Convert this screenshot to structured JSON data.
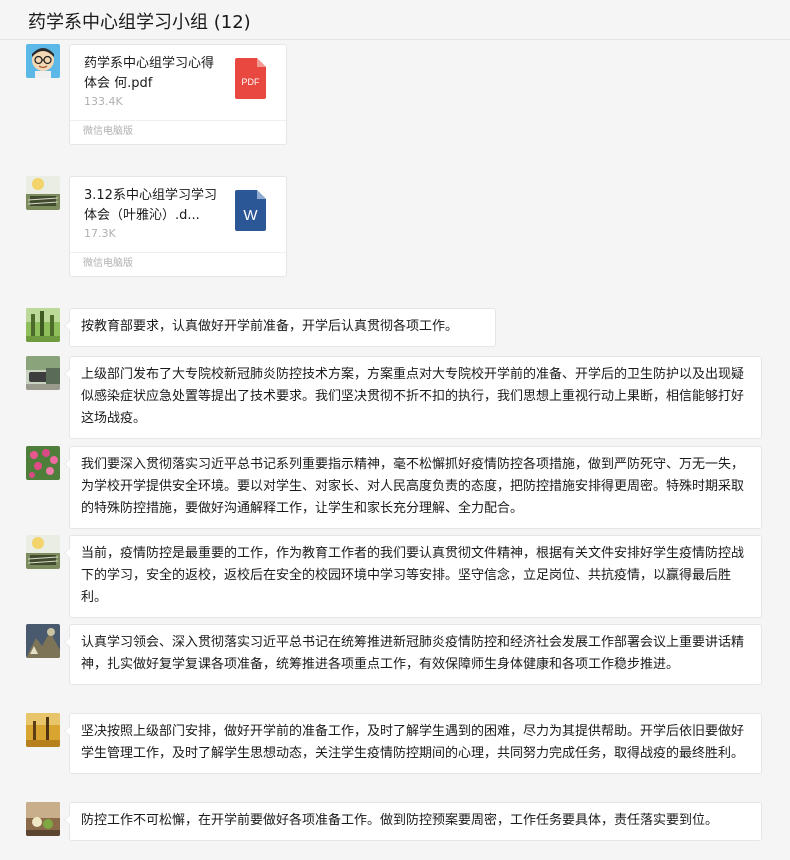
{
  "header": {
    "title": "药学系中心组学习小组 (12)"
  },
  "messages": [
    {
      "type": "file",
      "file_name": "药学系中心组学习心得体会 何.pdf",
      "file_size": "133.4K",
      "file_icon": "pdf-file-icon",
      "icon_label": "PDF",
      "icon_color": "#e8483f",
      "source": "微信电脑版"
    },
    {
      "type": "file",
      "file_name": "3.12系中心组学习学习体会（叶雅沁）.d...",
      "file_size": "17.3K",
      "file_icon": "word-file-icon",
      "icon_label": "W",
      "icon_color": "#2b5797",
      "source": "微信电脑版"
    },
    {
      "type": "text",
      "text": "按教育部要求，认真做好开学前准备，开学后认真贯彻各项工作。"
    },
    {
      "type": "text",
      "text": "上级部门发布了大专院校新冠肺炎防控技术方案，方案重点对大专院校开学前的准备、开学后的卫生防护以及出现疑似感染症状应急处置等提出了技术要求。我们坚决贯彻不折不扣的执行，我们思想上重视行动上果断，相信能够打好这场战疫。"
    },
    {
      "type": "text",
      "text": "我们要深入贯彻落实习近平总书记系列重要指示精神，毫不松懈抓好疫情防控各项措施，做到严防死守、万无一失，为学校开学提供安全环境。要以对学生、对家长、对人民高度负责的态度，把防控措施安排得更周密。特殊时期采取的特殊防控措施，要做好沟通解释工作，让学生和家长充分理解、全力配合。"
    },
    {
      "type": "text",
      "text": "当前，疫情防控是最重要的工作，作为教育工作者的我们要认真贯彻文件精神，根据有关文件安排好学生疫情防控战下的学习，安全的返校，返校后在安全的校园环境中学习等安排。坚守信念，立足岗位、共抗疫情，以赢得最后胜利。"
    },
    {
      "type": "text",
      "text": "认真学习领会、深入贯彻落实习近平总书记在统筹推进新冠肺炎疫情防控和经济社会发展工作部署会议上重要讲话精神，扎实做好复学复课各项准备，统筹推进各项重点工作，有效保障师生身体健康和各项工作稳步推进。"
    },
    {
      "type": "text",
      "text": "坚决按照上级部门安排，做好开学前的准备工作，及时了解学生遇到的困难，尽力为其提供帮助。开学后依旧要做好学生管理工作，及时了解学生思想动态，关注学生疫情防控期间的心理，共同努力完成任务，取得战疫的最终胜利。"
    },
    {
      "type": "text",
      "text": "防控工作不可松懈，在开学前要做好各项准备工作。做到防控预案要周密，工作任务要具体，责任落实要到位。"
    }
  ]
}
